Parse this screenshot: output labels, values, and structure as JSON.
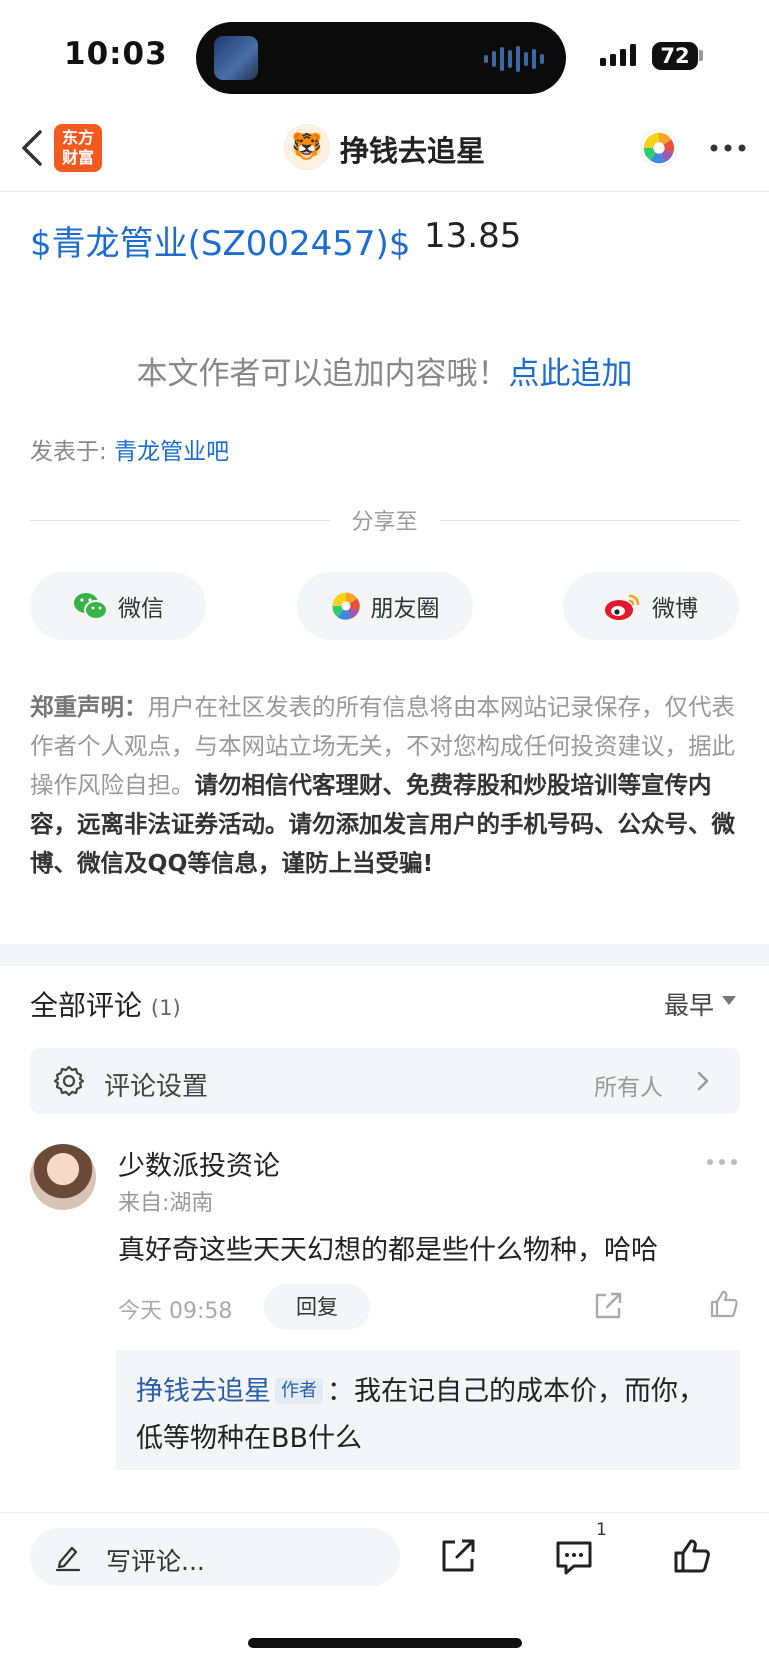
{
  "status_bar": {
    "time": "10:03",
    "battery": "72"
  },
  "nav": {
    "logo_text": "东方\n财富",
    "title": "挣钱去追星"
  },
  "post": {
    "stock_link": "$青龙管业(SZ002457)$",
    "stock_price": "13.85",
    "append_hint": "本文作者可以追加内容哦！",
    "append_link": "点此追加",
    "posted_label": "发表于: ",
    "posted_forum": "青龙管业吧"
  },
  "share": {
    "title": "分享至",
    "buttons": [
      {
        "label": "微信",
        "icon": "wechat-icon"
      },
      {
        "label": "朋友圈",
        "icon": "moments-icon"
      },
      {
        "label": "微博",
        "icon": "weibo-icon"
      }
    ]
  },
  "disclaimer": {
    "heading": "郑重声明：",
    "normal": "用户在社区发表的所有信息将由本网站记录保存，仅代表作者个人观点，与本网站立场无关，不对您构成任何投资建议，据此操作风险自担。",
    "bold": "请勿相信代客理财、免费荐股和炒股培训等宣传内容，远离非法证券活动。请勿添加发言用户的手机号码、公众号、微博、微信及QQ等信息，谨防上当受骗!"
  },
  "comments": {
    "title": "全部评论",
    "count": "(1)",
    "sort": "最早",
    "settings_label": "评论设置",
    "settings_value": "所有人",
    "items": [
      {
        "name": "少数派投资论",
        "location": "来自:湖南",
        "text": "真好奇这些天天幻想的都是些什么物种，哈哈",
        "time": "今天 09:58",
        "reply_label": "回复",
        "reply": {
          "author": "挣钱去追星",
          "tag": "作者",
          "separator": "：",
          "text": "我在记自己的成本价，而你，低等物种在BB什么"
        }
      }
    ]
  },
  "bottom_bar": {
    "placeholder": "写评论...",
    "comment_count": "1"
  },
  "colors": {
    "link": "#1d6ccf",
    "brand": "#f25a1e",
    "reply_name": "#2a5fa6"
  }
}
